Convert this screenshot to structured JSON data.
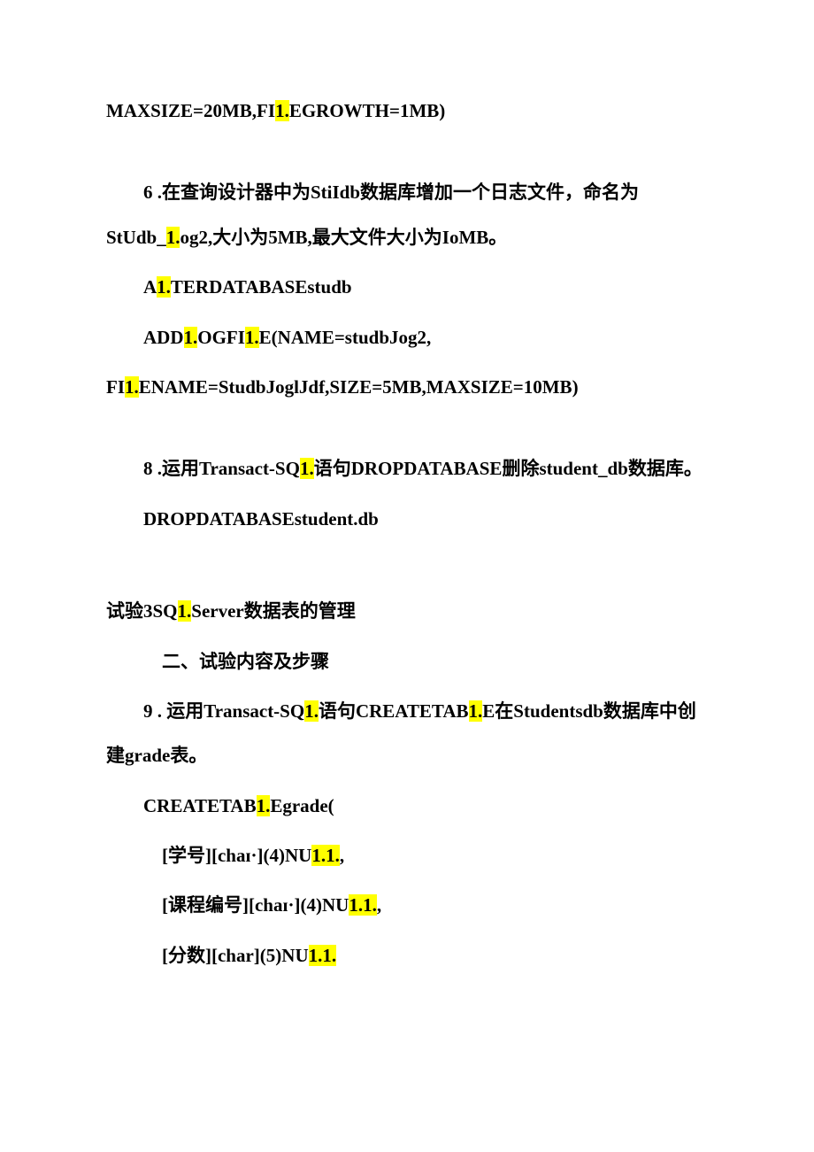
{
  "p1_a": "MAXSIZE=20MB,FI",
  "p1_hl": "1.",
  "p1_b": "EGROWTH=1MB)",
  "p2_a": "6 .在查询设计器中为StiIdb数据库增加一个日志文件，命名为StUdb_",
  "p2_hl": "1.",
  "p2_b": "og2,大小为5MB,最大文件大小为IoMB。",
  "p3_a": "A",
  "p3_hl": "1.",
  "p3_b": "TERDATABASEstudb",
  "p4_a": "ADD",
  "p4_hl1": "1.",
  "p4_b": "OGFI",
  "p4_hl2": "1.",
  "p4_c": "E(NAME=",
  "p4_d": "studbJog2,",
  "p5_a": "FI",
  "p5_hl": "1.",
  "p5_b": "ENAME=StudbJoglJdf,SIZE=5MB,MAXSIZE=10MB)",
  "p6_a": "8 .运用Transact-SQ",
  "p6_hl": "1.",
  "p6_b": "语句DROPDATABASE删除student_db数据库。",
  "p7": "DROPDATABASEstudent.db",
  "p8_a": "试验3SQ",
  "p8_hl": "1.",
  "p8_b": "Server数据表的管理",
  "p9": "二、试验内容及步骤",
  "p10_a": "9 . 运用Transact-SQ",
  "p10_hl1": "1.",
  "p10_b": "语句CREATETAB",
  "p10_hl2": "1.",
  "p10_c": "E在Studentsdb数据库中创建grade表。",
  "p11_a": "CREATETAB",
  "p11_hl": "1.",
  "p11_b": "Egrade(",
  "p12_a": "[学号][chaɪ·](4)NU",
  "p12_hl": "1.1.",
  "p12_b": ",",
  "p13_a": "[课程编号][chaɪ·](4)NU",
  "p13_hl": "1.1.",
  "p13_b": ",",
  "p14_a": "[分数][char](5)NU",
  "p14_hl": "1.1."
}
